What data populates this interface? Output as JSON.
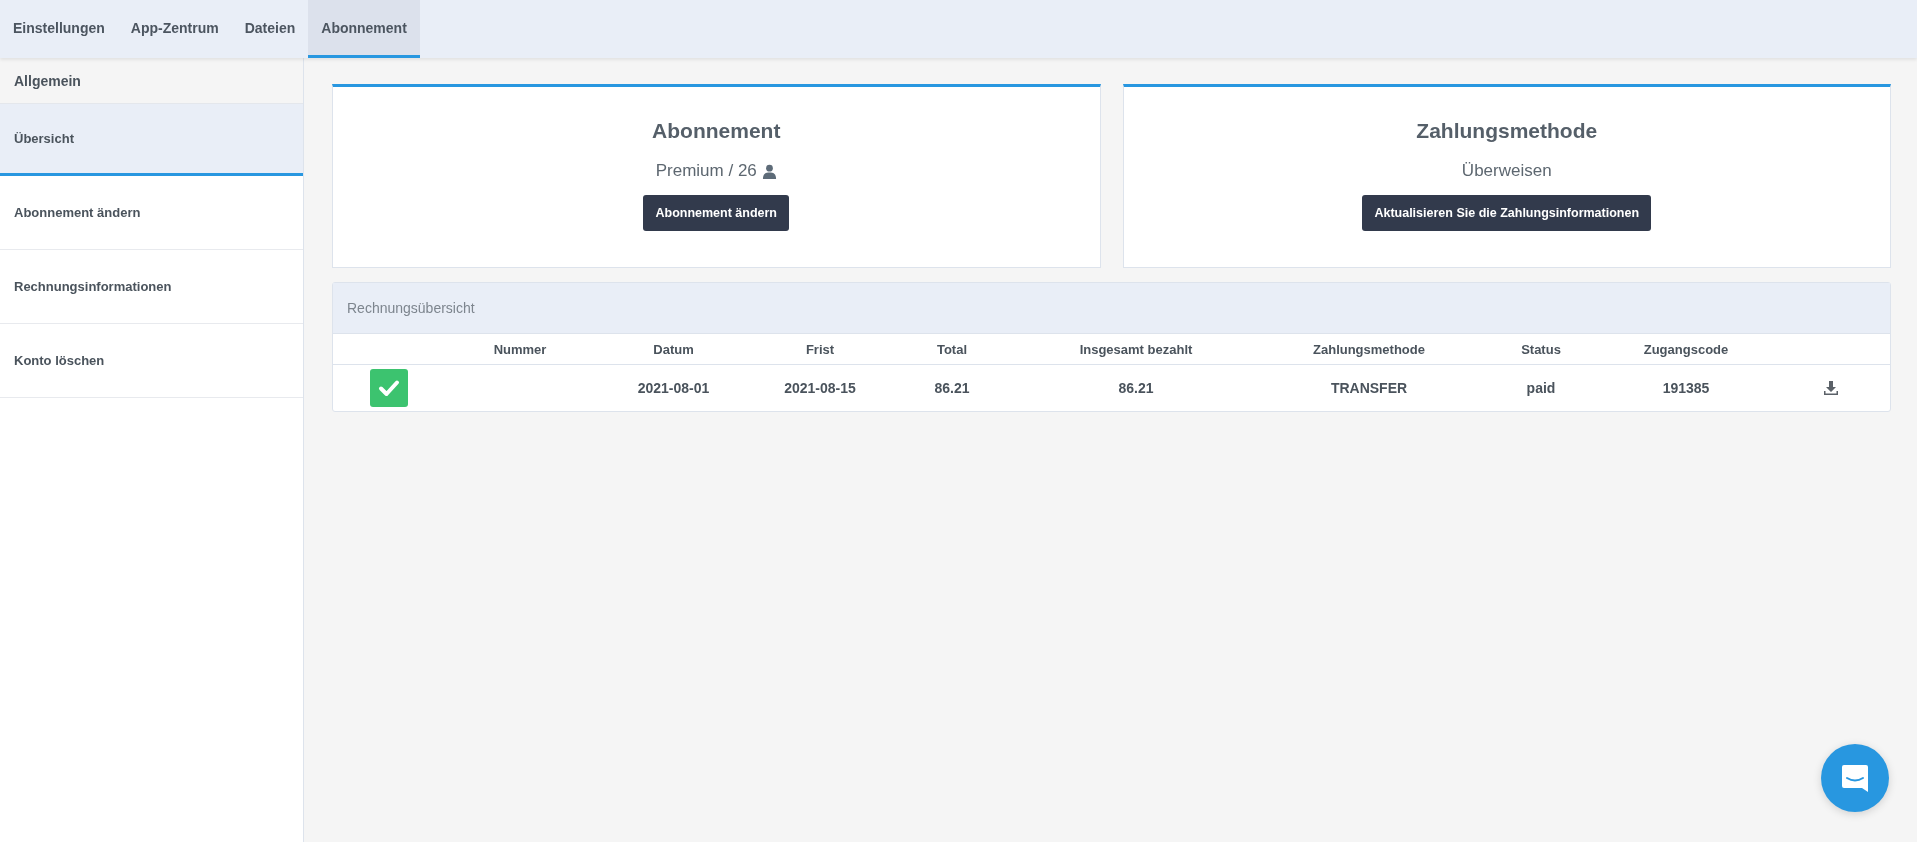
{
  "tabs": [
    {
      "label": "Einstellungen",
      "selected": false
    },
    {
      "label": "App-Zentrum",
      "selected": false
    },
    {
      "label": "Dateien",
      "selected": false
    },
    {
      "label": "Abonnement",
      "selected": true
    }
  ],
  "sidebar": {
    "heading": "Allgemein",
    "items": [
      {
        "label": "Übersicht",
        "selected": true
      },
      {
        "label": "Abonnement ändern",
        "selected": false
      },
      {
        "label": "Rechnungsinformationen",
        "selected": false
      },
      {
        "label": "Konto löschen",
        "selected": false
      }
    ]
  },
  "cards": [
    {
      "title": "Abonnement",
      "detail": "Premium / 26",
      "kind": "users",
      "button": "Abonnement ändern"
    },
    {
      "title": "Zahlungsmethode",
      "detail": "Überweisen",
      "kind": "plain",
      "button": "Aktualisieren Sie die Zahlungsinformationen"
    }
  ],
  "invoices": {
    "title": "Rechnungsübersicht",
    "columns": [
      "Nummer",
      "Datum",
      "Frist",
      "Total",
      "Insgesamt bezahlt",
      "Zahlungsmethode",
      "Status",
      "Zugangscode"
    ],
    "rows": [
      {
        "cells": [
          "",
          "2021-08-01",
          "2021-08-15",
          "86.21",
          "86.21",
          "TRANSFER",
          "paid",
          "191385"
        ]
      }
    ]
  }
}
